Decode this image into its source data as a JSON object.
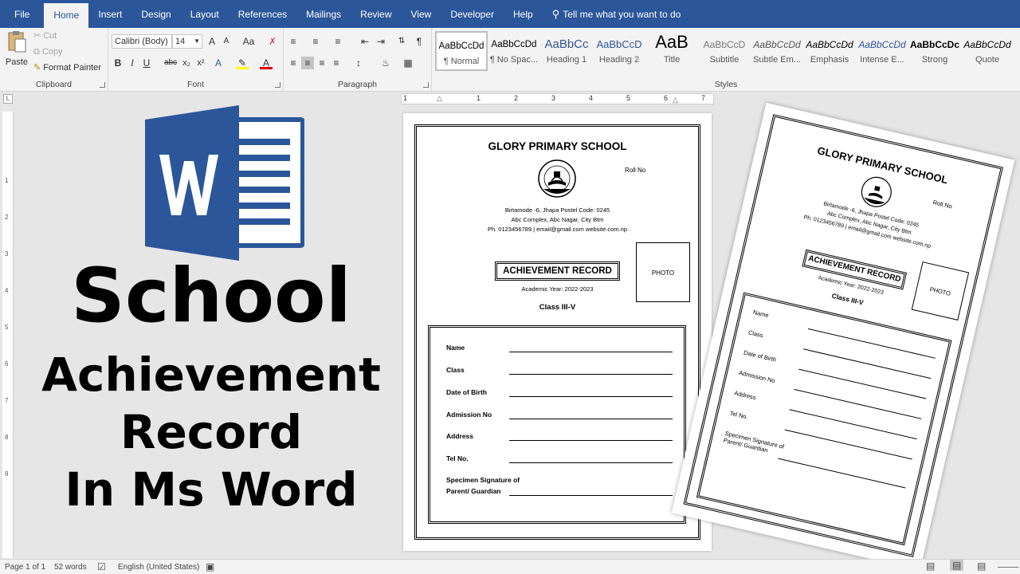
{
  "menu": {
    "tabs": [
      "File",
      "Home",
      "Insert",
      "Design",
      "Layout",
      "References",
      "Mailings",
      "Review",
      "View",
      "Developer",
      "Help"
    ],
    "active_tab": "Home",
    "tell_me": "Tell me what you want to do"
  },
  "ribbon": {
    "clipboard": {
      "label": "Clipboard",
      "paste": "Paste",
      "cut": "Cut",
      "copy": "Copy",
      "format_painter": "Format Painter"
    },
    "font": {
      "label": "Font",
      "font_name": "Calibri (Body)",
      "font_size": "14"
    },
    "paragraph": {
      "label": "Paragraph"
    },
    "styles": {
      "label": "Styles",
      "items": [
        {
          "sample": "AaBbCcDd",
          "name": "¶ Normal"
        },
        {
          "sample": "AaBbCcDd",
          "name": "¶ No Spac..."
        },
        {
          "sample": "AaBbCc",
          "name": "Heading 1"
        },
        {
          "sample": "AaBbCcD",
          "name": "Heading 2"
        },
        {
          "sample": "AaB",
          "name": "Title"
        },
        {
          "sample": "AaBbCcD",
          "name": "Subtitle"
        },
        {
          "sample": "AaBbCcDd",
          "name": "Subtle Em..."
        },
        {
          "sample": "AaBbCcDd",
          "name": "Emphasis"
        },
        {
          "sample": "AaBbCcDd",
          "name": "Intense E..."
        },
        {
          "sample": "AaBbCcDc",
          "name": "Strong"
        },
        {
          "sample": "AaBbCcDd",
          "name": "Quote"
        }
      ]
    }
  },
  "ruler": {
    "marks": [
      "1",
      "1",
      "2",
      "3",
      "4",
      "5",
      "6",
      "7"
    ],
    "vmarks": [
      "1",
      "2",
      "3",
      "4",
      "5",
      "6",
      "7",
      "8",
      "9"
    ]
  },
  "headline": {
    "line1": "School",
    "line2": "Achievement",
    "line3": "Record",
    "line4": "In Ms Word"
  },
  "document": {
    "school_name": "GLORY PRIMARY SCHOOL",
    "logo_text": "GLORY PRIMARY SCHOOL",
    "logo_est": "ESTD. 2021",
    "roll_no": "Roll No",
    "address_line1": "Birtamode -6, Jhapa Postel Code: 0245",
    "address_line2": "Abc Complex, Abc Nagar, City Btm",
    "address_line3": "Ph. 0123456789 | email@gmail.com website.com.np",
    "photo": "PHOTO",
    "title": "ACHIEVEMENT RECORD",
    "academic_year": "Academic Year: 2022-2023",
    "class": "Class III-V",
    "fields": [
      {
        "label": "Name"
      },
      {
        "label": "Class"
      },
      {
        "label": "Date of Birth"
      },
      {
        "label": "Admission No"
      },
      {
        "label": "Address"
      },
      {
        "label": "Tel No."
      }
    ],
    "signature_line1": "Specimen Signature of",
    "signature_line2": "Parent/ Guardian"
  },
  "status": {
    "page": "Page 1 of 1",
    "words": "52 words",
    "language": "English (United States)"
  },
  "colors": {
    "word_blue": "#2b579a",
    "logo_blue": "#2b579a"
  }
}
